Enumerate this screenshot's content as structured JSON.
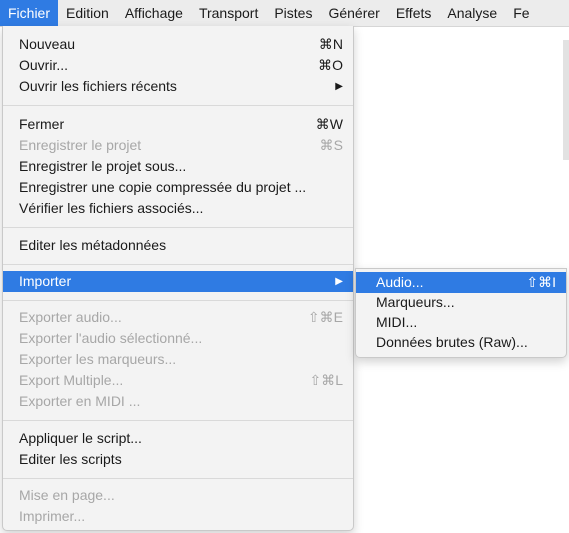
{
  "menubar": {
    "items": [
      "Fichier",
      "Edition",
      "Affichage",
      "Transport",
      "Pistes",
      "Générer",
      "Effets",
      "Analyse",
      "Fe"
    ]
  },
  "menu": {
    "nouveau": {
      "label": "Nouveau",
      "shortcut": "⌘N"
    },
    "ouvrir": {
      "label": "Ouvrir...",
      "shortcut": "⌘O"
    },
    "recents": {
      "label": "Ouvrir les fichiers récents",
      "arrow": "▶"
    },
    "fermer": {
      "label": "Fermer",
      "shortcut": "⌘W"
    },
    "enregistrer": {
      "label": "Enregistrer le projet",
      "shortcut": "⌘S"
    },
    "enregistrer_sous": {
      "label": "Enregistrer le projet sous..."
    },
    "copie_compressee": {
      "label": "Enregistrer une copie compressée du projet ..."
    },
    "verifier": {
      "label": "Vérifier les fichiers associés..."
    },
    "metadonnees": {
      "label": "Editer les métadonnées"
    },
    "importer": {
      "label": "Importer",
      "arrow": "▶"
    },
    "exporter_audio": {
      "label": "Exporter audio...",
      "shortcut": "⇧⌘E"
    },
    "exporter_selection": {
      "label": "Exporter l'audio sélectionné..."
    },
    "exporter_marqueurs": {
      "label": "Exporter les marqueurs..."
    },
    "export_multiple": {
      "label": "Export Multiple...",
      "shortcut": "⇧⌘L"
    },
    "exporter_midi": {
      "label": "Exporter en MIDI ..."
    },
    "appliquer_script": {
      "label": "Appliquer le script..."
    },
    "editer_scripts": {
      "label": "Editer les scripts"
    },
    "mise_en_page": {
      "label": "Mise en page..."
    },
    "imprimer": {
      "label": "Imprimer..."
    }
  },
  "submenu": {
    "audio": {
      "label": "Audio...",
      "shortcut": "⇧⌘I"
    },
    "marqueurs": {
      "label": "Marqueurs..."
    },
    "midi": {
      "label": "MIDI..."
    },
    "raw": {
      "label": "Données brutes (Raw)..."
    }
  },
  "colors": {
    "accent": "#2f7be3",
    "disabled": "#a7a7a7",
    "menu_bg": "#f3f3f3"
  }
}
